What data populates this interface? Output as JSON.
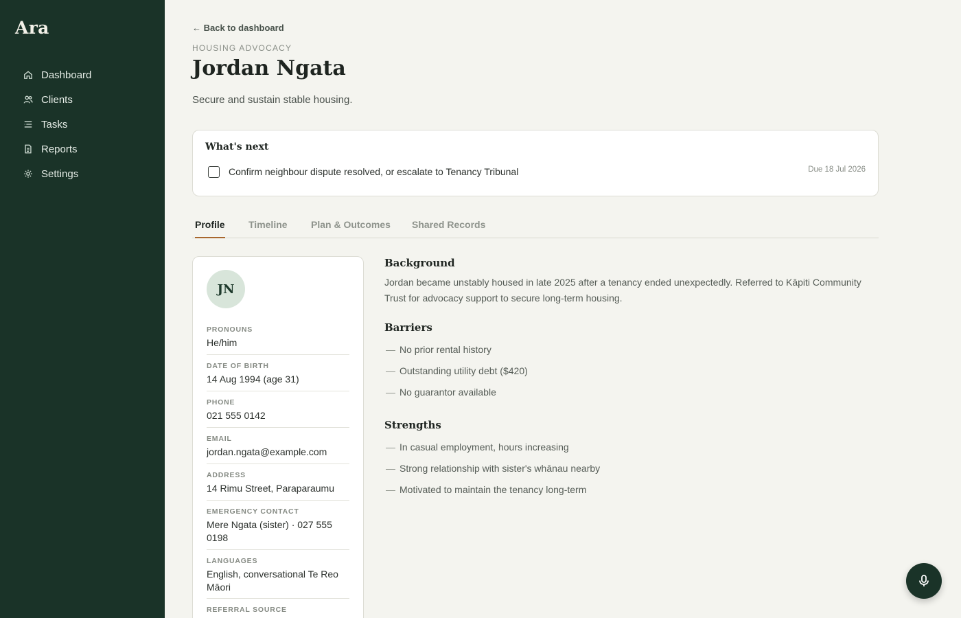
{
  "app": {
    "name": "Ara"
  },
  "sidebar": {
    "items": [
      {
        "label": "Dashboard",
        "icon": "home-icon"
      },
      {
        "label": "Clients",
        "icon": "users-icon"
      },
      {
        "label": "Tasks",
        "icon": "list-icon"
      },
      {
        "label": "Reports",
        "icon": "document-icon"
      },
      {
        "label": "Settings",
        "icon": "gear-icon"
      }
    ]
  },
  "header": {
    "back_link": "← Back to dashboard",
    "eyebrow": "HOUSING ADVOCACY",
    "title": "Jordan Ngata",
    "subtitle": "Secure and sustain stable housing."
  },
  "next": {
    "heading": "What's next",
    "task": "Confirm neighbour dispute resolved, or escalate to Tenancy Tribunal",
    "due": "Due 18 Jul 2026",
    "checked": false
  },
  "tabs": [
    {
      "label": "Profile",
      "active": true
    },
    {
      "label": "Timeline",
      "active": false
    },
    {
      "label": "Plan & Outcomes",
      "active": false
    },
    {
      "label": "Shared Records",
      "active": false
    }
  ],
  "profile": {
    "initials": "JN",
    "fields": [
      {
        "label": "PRONOUNS",
        "value": "He/him"
      },
      {
        "label": "DATE OF BIRTH",
        "value": "14 Aug 1994 (age 31)"
      },
      {
        "label": "PHONE",
        "value": "021 555 0142"
      },
      {
        "label": "EMAIL",
        "value": "jordan.ngata@example.com"
      },
      {
        "label": "ADDRESS",
        "value": "14 Rimu Street, Paraparaumu"
      },
      {
        "label": "EMERGENCY CONTACT",
        "value": "Mere Ngata (sister) · 027 555 0198"
      },
      {
        "label": "LANGUAGES",
        "value": "English, conversational Te Reo Māori"
      },
      {
        "label": "REFERRAL SOURCE",
        "value": ""
      }
    ]
  },
  "background": {
    "heading": "Background",
    "text": "Jordan became unstably housed in late 2025 after a tenancy ended unexpectedly. Referred to Kāpiti Community Trust for advocacy support to secure long-term housing."
  },
  "barriers": {
    "heading": "Barriers",
    "items": [
      "No prior rental history",
      "Outstanding utility debt ($420)",
      "No guarantor available"
    ]
  },
  "strengths": {
    "heading": "Strengths",
    "items": [
      "In casual employment, hours increasing",
      "Strong relationship with sister's whānau nearby",
      "Motivated to maintain the tenancy long-term"
    ]
  },
  "fab": {
    "icon": "microphone-icon"
  },
  "colors": {
    "sidebar": "#1a3328",
    "accent": "#a8672e",
    "background": "#f4f4ef"
  }
}
